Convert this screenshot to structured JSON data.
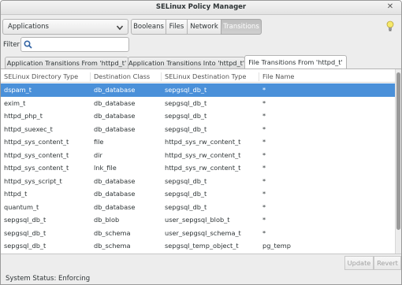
{
  "window": {
    "title": "SELinux Policy Manager"
  },
  "toolbar": {
    "app_select_value": "Applications",
    "buttons": [
      "Booleans",
      "Files",
      "Network",
      "Transitions"
    ],
    "active_button": "Transitions"
  },
  "filter": {
    "label": "Filter",
    "value": ""
  },
  "tabs": [
    "Application Transitions From 'httpd_t'",
    "Application Transitions Into 'httpd_t'",
    "File Transitions From 'httpd_t'"
  ],
  "active_tab": "File Transitions From 'httpd_t'",
  "table": {
    "columns": [
      "SELinux Directory Type",
      "Destination Class",
      "SELinux Destination Type",
      "File Name"
    ],
    "rows": [
      [
        "dspam_t",
        "db_database",
        "sepgsql_db_t",
        "*"
      ],
      [
        "exim_t",
        "db_database",
        "sepgsql_db_t",
        "*"
      ],
      [
        "httpd_php_t",
        "db_database",
        "sepgsql_db_t",
        "*"
      ],
      [
        "httpd_suexec_t",
        "db_database",
        "sepgsql_db_t",
        "*"
      ],
      [
        "httpd_sys_content_t",
        "file",
        "httpd_sys_rw_content_t",
        "*"
      ],
      [
        "httpd_sys_content_t",
        "dir",
        "httpd_sys_rw_content_t",
        "*"
      ],
      [
        "httpd_sys_content_t",
        "lnk_file",
        "httpd_sys_rw_content_t",
        "*"
      ],
      [
        "httpd_sys_script_t",
        "db_database",
        "sepgsql_db_t",
        "*"
      ],
      [
        "httpd_t",
        "db_database",
        "sepgsql_db_t",
        "*"
      ],
      [
        "quantum_t",
        "db_database",
        "sepgsql_db_t",
        "*"
      ],
      [
        "sepgsql_db_t",
        "db_blob",
        "user_sepgsql_blob_t",
        "*"
      ],
      [
        "sepgsql_db_t",
        "db_schema",
        "user_sepgsql_schema_t",
        "*"
      ],
      [
        "sepgsql_db_t",
        "db_schema",
        "sepgsql_temp_object_t",
        "pg_temp"
      ]
    ],
    "selected_row": 0
  },
  "actions": {
    "update": "Update",
    "revert": "Revert"
  },
  "status": "System Status: Enforcing",
  "colors": {
    "selection": "#4a90d9",
    "window_bg": "#ededed"
  }
}
